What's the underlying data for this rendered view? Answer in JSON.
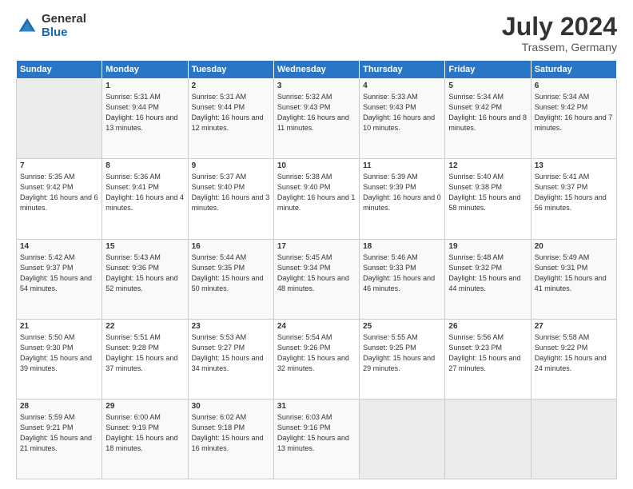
{
  "logo": {
    "general": "General",
    "blue": "Blue"
  },
  "title": "July 2024",
  "location": "Trassem, Germany",
  "days_of_week": [
    "Sunday",
    "Monday",
    "Tuesday",
    "Wednesday",
    "Thursday",
    "Friday",
    "Saturday"
  ],
  "weeks": [
    [
      {
        "num": "",
        "sunrise": "",
        "sunset": "",
        "daylight": ""
      },
      {
        "num": "1",
        "sunrise": "Sunrise: 5:31 AM",
        "sunset": "Sunset: 9:44 PM",
        "daylight": "Daylight: 16 hours and 13 minutes."
      },
      {
        "num": "2",
        "sunrise": "Sunrise: 5:31 AM",
        "sunset": "Sunset: 9:44 PM",
        "daylight": "Daylight: 16 hours and 12 minutes."
      },
      {
        "num": "3",
        "sunrise": "Sunrise: 5:32 AM",
        "sunset": "Sunset: 9:43 PM",
        "daylight": "Daylight: 16 hours and 11 minutes."
      },
      {
        "num": "4",
        "sunrise": "Sunrise: 5:33 AM",
        "sunset": "Sunset: 9:43 PM",
        "daylight": "Daylight: 16 hours and 10 minutes."
      },
      {
        "num": "5",
        "sunrise": "Sunrise: 5:34 AM",
        "sunset": "Sunset: 9:42 PM",
        "daylight": "Daylight: 16 hours and 8 minutes."
      },
      {
        "num": "6",
        "sunrise": "Sunrise: 5:34 AM",
        "sunset": "Sunset: 9:42 PM",
        "daylight": "Daylight: 16 hours and 7 minutes."
      }
    ],
    [
      {
        "num": "7",
        "sunrise": "Sunrise: 5:35 AM",
        "sunset": "Sunset: 9:42 PM",
        "daylight": "Daylight: 16 hours and 6 minutes."
      },
      {
        "num": "8",
        "sunrise": "Sunrise: 5:36 AM",
        "sunset": "Sunset: 9:41 PM",
        "daylight": "Daylight: 16 hours and 4 minutes."
      },
      {
        "num": "9",
        "sunrise": "Sunrise: 5:37 AM",
        "sunset": "Sunset: 9:40 PM",
        "daylight": "Daylight: 16 hours and 3 minutes."
      },
      {
        "num": "10",
        "sunrise": "Sunrise: 5:38 AM",
        "sunset": "Sunset: 9:40 PM",
        "daylight": "Daylight: 16 hours and 1 minute."
      },
      {
        "num": "11",
        "sunrise": "Sunrise: 5:39 AM",
        "sunset": "Sunset: 9:39 PM",
        "daylight": "Daylight: 16 hours and 0 minutes."
      },
      {
        "num": "12",
        "sunrise": "Sunrise: 5:40 AM",
        "sunset": "Sunset: 9:38 PM",
        "daylight": "Daylight: 15 hours and 58 minutes."
      },
      {
        "num": "13",
        "sunrise": "Sunrise: 5:41 AM",
        "sunset": "Sunset: 9:37 PM",
        "daylight": "Daylight: 15 hours and 56 minutes."
      }
    ],
    [
      {
        "num": "14",
        "sunrise": "Sunrise: 5:42 AM",
        "sunset": "Sunset: 9:37 PM",
        "daylight": "Daylight: 15 hours and 54 minutes."
      },
      {
        "num": "15",
        "sunrise": "Sunrise: 5:43 AM",
        "sunset": "Sunset: 9:36 PM",
        "daylight": "Daylight: 15 hours and 52 minutes."
      },
      {
        "num": "16",
        "sunrise": "Sunrise: 5:44 AM",
        "sunset": "Sunset: 9:35 PM",
        "daylight": "Daylight: 15 hours and 50 minutes."
      },
      {
        "num": "17",
        "sunrise": "Sunrise: 5:45 AM",
        "sunset": "Sunset: 9:34 PM",
        "daylight": "Daylight: 15 hours and 48 minutes."
      },
      {
        "num": "18",
        "sunrise": "Sunrise: 5:46 AM",
        "sunset": "Sunset: 9:33 PM",
        "daylight": "Daylight: 15 hours and 46 minutes."
      },
      {
        "num": "19",
        "sunrise": "Sunrise: 5:48 AM",
        "sunset": "Sunset: 9:32 PM",
        "daylight": "Daylight: 15 hours and 44 minutes."
      },
      {
        "num": "20",
        "sunrise": "Sunrise: 5:49 AM",
        "sunset": "Sunset: 9:31 PM",
        "daylight": "Daylight: 15 hours and 41 minutes."
      }
    ],
    [
      {
        "num": "21",
        "sunrise": "Sunrise: 5:50 AM",
        "sunset": "Sunset: 9:30 PM",
        "daylight": "Daylight: 15 hours and 39 minutes."
      },
      {
        "num": "22",
        "sunrise": "Sunrise: 5:51 AM",
        "sunset": "Sunset: 9:28 PM",
        "daylight": "Daylight: 15 hours and 37 minutes."
      },
      {
        "num": "23",
        "sunrise": "Sunrise: 5:53 AM",
        "sunset": "Sunset: 9:27 PM",
        "daylight": "Daylight: 15 hours and 34 minutes."
      },
      {
        "num": "24",
        "sunrise": "Sunrise: 5:54 AM",
        "sunset": "Sunset: 9:26 PM",
        "daylight": "Daylight: 15 hours and 32 minutes."
      },
      {
        "num": "25",
        "sunrise": "Sunrise: 5:55 AM",
        "sunset": "Sunset: 9:25 PM",
        "daylight": "Daylight: 15 hours and 29 minutes."
      },
      {
        "num": "26",
        "sunrise": "Sunrise: 5:56 AM",
        "sunset": "Sunset: 9:23 PM",
        "daylight": "Daylight: 15 hours and 27 minutes."
      },
      {
        "num": "27",
        "sunrise": "Sunrise: 5:58 AM",
        "sunset": "Sunset: 9:22 PM",
        "daylight": "Daylight: 15 hours and 24 minutes."
      }
    ],
    [
      {
        "num": "28",
        "sunrise": "Sunrise: 5:59 AM",
        "sunset": "Sunset: 9:21 PM",
        "daylight": "Daylight: 15 hours and 21 minutes."
      },
      {
        "num": "29",
        "sunrise": "Sunrise: 6:00 AM",
        "sunset": "Sunset: 9:19 PM",
        "daylight": "Daylight: 15 hours and 18 minutes."
      },
      {
        "num": "30",
        "sunrise": "Sunrise: 6:02 AM",
        "sunset": "Sunset: 9:18 PM",
        "daylight": "Daylight: 15 hours and 16 minutes."
      },
      {
        "num": "31",
        "sunrise": "Sunrise: 6:03 AM",
        "sunset": "Sunset: 9:16 PM",
        "daylight": "Daylight: 15 hours and 13 minutes."
      },
      {
        "num": "",
        "sunrise": "",
        "sunset": "",
        "daylight": ""
      },
      {
        "num": "",
        "sunrise": "",
        "sunset": "",
        "daylight": ""
      },
      {
        "num": "",
        "sunrise": "",
        "sunset": "",
        "daylight": ""
      }
    ]
  ]
}
